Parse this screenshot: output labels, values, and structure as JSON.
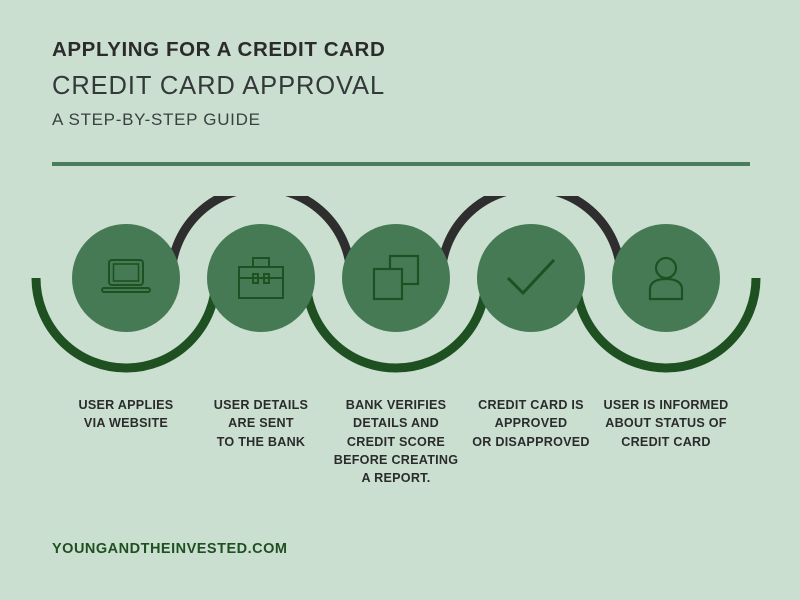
{
  "header": {
    "kicker": "APPLYING FOR A CREDIT CARD",
    "title": "CREDIT CARD APPROVAL",
    "subtitle": "A STEP-BY-STEP GUIDE"
  },
  "footer": {
    "site": "YOUNGANDTHEINVESTED.COM"
  },
  "colors": {
    "background": "#cbdfd1",
    "circle_fill": "#457a55",
    "arc_dark_green": "#1f5021",
    "arc_charcoal": "#2e2e2e",
    "divider": "#4a7d59",
    "icon_stroke": "#1f5021",
    "heading_text": "#2b2b2b",
    "footer_text": "#1f5021"
  },
  "steps": [
    {
      "index": "1",
      "icon": "laptop-icon",
      "arc_position": "bottom",
      "arc_color": "#1f5021",
      "caption_lines": [
        "USER APPLIES",
        "VIA WEBSITE"
      ]
    },
    {
      "index": "2",
      "icon": "briefcase-icon",
      "arc_position": "top",
      "arc_color": "#2e2e2e",
      "caption_lines": [
        "USER DETAILS",
        "ARE SENT",
        "TO THE BANK"
      ]
    },
    {
      "index": "3",
      "icon": "documents-icon",
      "arc_position": "bottom",
      "arc_color": "#1f5021",
      "caption_lines": [
        "BANK VERIFIES",
        "DETAILS AND",
        "CREDIT SCORE",
        "BEFORE CREATING",
        "A REPORT."
      ]
    },
    {
      "index": "4",
      "icon": "checkmark-icon",
      "arc_position": "top",
      "arc_color": "#2e2e2e",
      "caption_lines": [
        "CREDIT CARD IS",
        "APPROVED",
        "OR DISAPPROVED"
      ]
    },
    {
      "index": "5",
      "icon": "user-icon",
      "arc_position": "bottom",
      "arc_color": "#1f5021",
      "caption_lines": [
        "USER IS INFORMED",
        "ABOUT STATUS OF",
        "CREDIT CARD"
      ]
    }
  ]
}
